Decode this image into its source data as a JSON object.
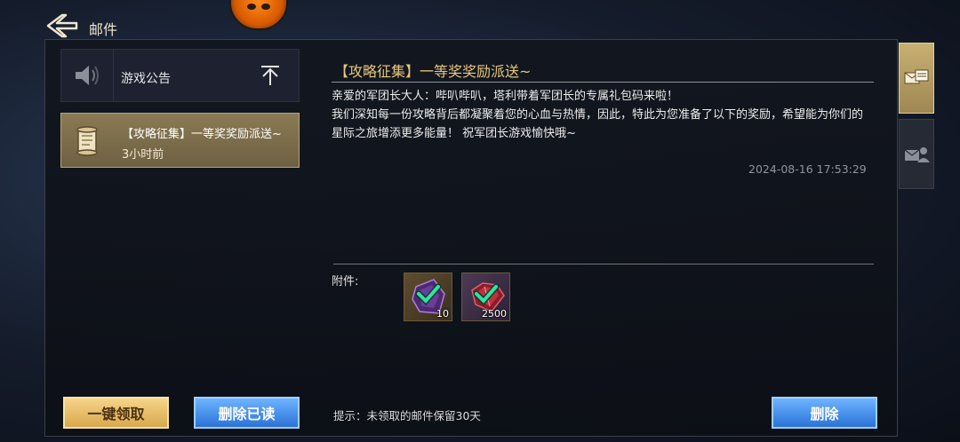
{
  "header": {
    "title": "邮件"
  },
  "mail_list": {
    "announcement_label": "游戏公告",
    "selected_mail": {
      "subject": "【攻略征集】一等奖奖励派送~",
      "time_ago": "3小时前"
    }
  },
  "mail_detail": {
    "title": "【攻略征集】一等奖奖励派送~",
    "body_lines": [
      "亲爱的军团长大人：哔叭哔叭，塔利带着军团长的专属礼包码来啦！",
      "我们深知每一份攻略背后都凝聚着您的心血与热情，因此，特此为您准备了以下的奖励，希望能为你们的星际之旅增添更多能量！ 祝军团长游戏愉快哦~"
    ],
    "datetime": "2024-08-16 17:53:29",
    "attachments_label": "附件:",
    "attachments": [
      {
        "icon": "purple-crystal-icon",
        "quantity": "10",
        "claimed": true
      },
      {
        "icon": "red-gem-icon",
        "quantity": "2500",
        "claimed": true
      }
    ],
    "hint": "提示：未领取的邮件保留30天"
  },
  "buttons": {
    "claim_all": "一键领取",
    "delete_read": "删除已读",
    "delete": "删除"
  },
  "side_tabs": [
    "mail-tab",
    "friend-mail-tab"
  ],
  "colors": {
    "gold": "#e8c77a",
    "blue_button": "#2a72d8",
    "gold_button": "#d9a84d"
  }
}
